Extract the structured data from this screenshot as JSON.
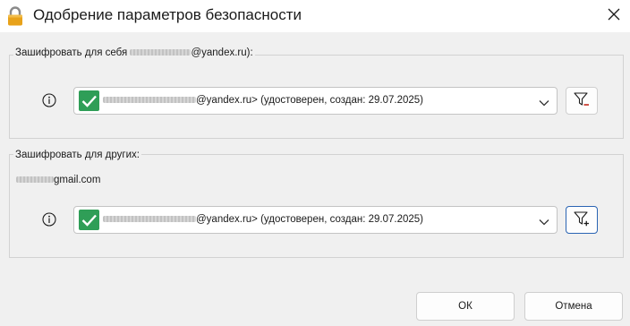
{
  "window": {
    "title": "Одобрение параметров безопасности",
    "icon": "lock-icon",
    "close_icon": "close-icon"
  },
  "self_group": {
    "label_prefix": "Зашифровать для себя",
    "label_suffix": "@yandex.ru):",
    "certificate": {
      "status_icon": "check-icon",
      "text": "@yandex.ru> (удостоверен, создан: 29.07.2025)"
    },
    "filter_icon": "filter-remove-icon"
  },
  "others_group": {
    "label": "Зашифровать для других:",
    "recipient_suffix": "gmail.com",
    "certificate": {
      "status_icon": "check-icon",
      "text": "@yandex.ru> (удостоверен, создан: 29.07.2025)"
    },
    "filter_icon": "filter-add-icon"
  },
  "buttons": {
    "ok": "ОК",
    "cancel": "Отмена"
  },
  "colors": {
    "check_green": "#2f9e57",
    "lock_orange": "#e8a21a",
    "focus_blue": "#2a64b3",
    "remove_red": "#c42b1c"
  }
}
